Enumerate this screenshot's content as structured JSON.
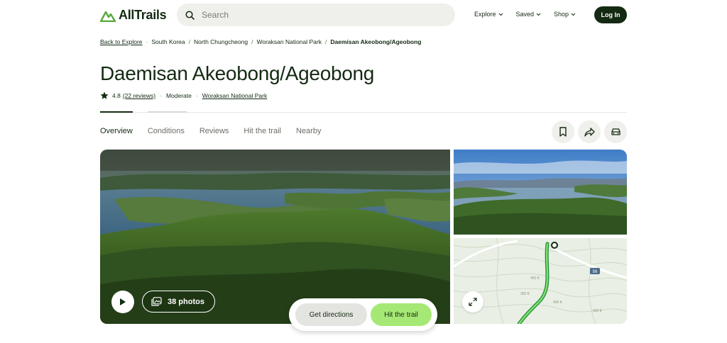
{
  "header": {
    "brand": "AllTrails",
    "search_placeholder": "Search",
    "nav": [
      {
        "label": "Explore"
      },
      {
        "label": "Saved"
      },
      {
        "label": "Shop"
      }
    ],
    "login_label": "Log In"
  },
  "breadcrumb": {
    "back": "Back to Explore",
    "items": [
      "South Korea",
      "North Chungcheong",
      "Woraksan National Park",
      "Daemisan Akeobong/Ageobong"
    ]
  },
  "trail": {
    "title": "Daemisan Akeobong/Ageobong",
    "rating": "4.8",
    "reviews": "(22 reviews)",
    "difficulty": "Moderate",
    "park": "Woraksan National Park"
  },
  "tabs": [
    {
      "label": "Overview"
    },
    {
      "label": "Conditions"
    },
    {
      "label": "Reviews"
    },
    {
      "label": "Hit the trail"
    },
    {
      "label": "Nearby"
    }
  ],
  "icons": {
    "bookmark": "bookmark-icon",
    "share": "share-icon",
    "car": "car-icon"
  },
  "gallery": {
    "photos_label": "38 photos"
  },
  "map": {
    "route_badge": "56",
    "contour_labels": [
      "450 ft",
      "600 ft",
      "350 ft",
      "400 ft"
    ]
  },
  "actions": {
    "directions_label": "Get directions",
    "hit_trail_label": "Hit the trail"
  },
  "colors": {
    "brand_dark": "#142a12",
    "accent_green": "#a6e875",
    "brand_logo": "#56a93b"
  }
}
